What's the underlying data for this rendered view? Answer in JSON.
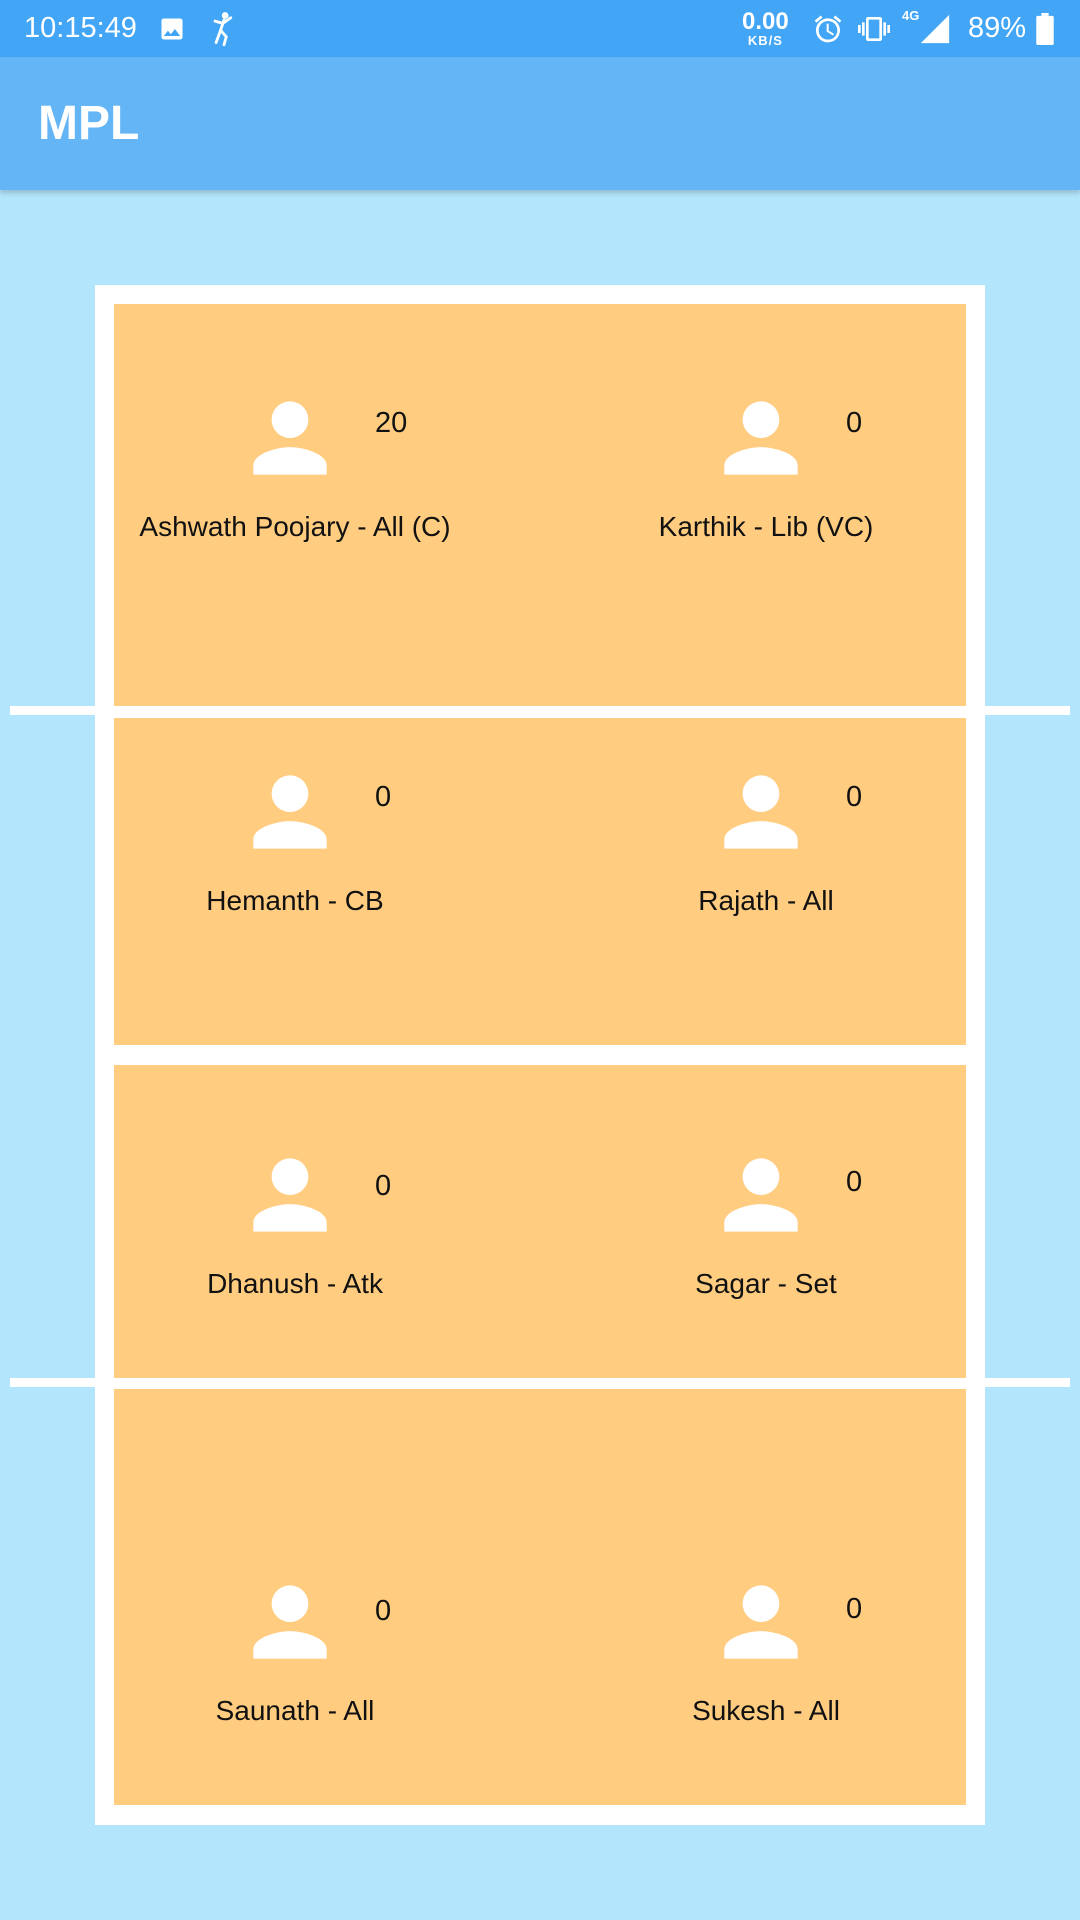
{
  "status_bar": {
    "time": "10:15:49",
    "speed_value": "0.00",
    "speed_unit": "KB/S",
    "network_type": "4G",
    "battery_percent": "89%",
    "icons": [
      "image-icon",
      "cricket-app-icon",
      "alarm-icon",
      "vibrate-icon",
      "signal-icon",
      "battery-icon"
    ]
  },
  "app_bar": {
    "title": "MPL"
  },
  "colors": {
    "status_bar": "#42a5f5",
    "app_bar": "#64b5f6",
    "background": "#b3e5fc",
    "court": "#ffcc80",
    "lines": "#ffffff"
  },
  "players": [
    {
      "name": "Ashwath Poojary - All (C)",
      "score": "20"
    },
    {
      "name": "Karthik - Lib (VC)",
      "score": "0"
    },
    {
      "name": "Hemanth - CB",
      "score": "0"
    },
    {
      "name": "Rajath - All",
      "score": "0"
    },
    {
      "name": "Dhanush - Atk",
      "score": "0"
    },
    {
      "name": "Sagar - Set",
      "score": "0"
    },
    {
      "name": "Saunath - All",
      "score": "0"
    },
    {
      "name": "Sukesh - All",
      "score": "0"
    }
  ]
}
